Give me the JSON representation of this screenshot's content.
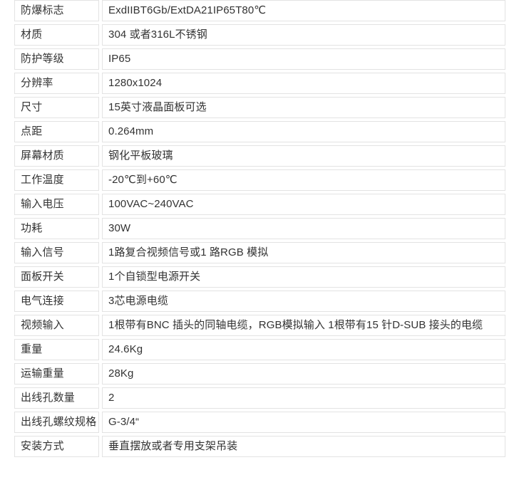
{
  "table": {
    "rows": [
      {
        "label": "防爆标志",
        "value": "ExdIIBT6Gb/ExtDA21IP65T80℃"
      },
      {
        "label": "材质",
        "value": "304 或者316L不锈钢"
      },
      {
        "label": "防护等级",
        "value": "IP65"
      },
      {
        "label": "分辨率",
        "value": "1280x1024"
      },
      {
        "label": "尺寸",
        "value": "15英寸液晶面板可选"
      },
      {
        "label": "点距",
        "value": "0.264mm"
      },
      {
        "label": "屏幕材质",
        "value": "钢化平板玻璃"
      },
      {
        "label": "工作温度",
        "value": "-20℃到+60℃"
      },
      {
        "label": "输入电压",
        "value": "100VAC~240VAC"
      },
      {
        "label": "功耗",
        "value": "30W"
      },
      {
        "label": "输入信号",
        "value": "1路复合视频信号或1 路RGB 模拟"
      },
      {
        "label": "面板开关",
        "value": "1个自锁型电源开关"
      },
      {
        "label": "电气连接",
        "value": "3芯电源电缆"
      },
      {
        "label": "视频输入",
        "value": "1根带有BNC 插头的同轴电缆，RGB模拟输入 1根带有15 针D-SUB 接头的电缆"
      },
      {
        "label": "重量",
        "value": "24.6Kg"
      },
      {
        "label": "运输重量",
        "value": "28Kg"
      },
      {
        "label": "出线孔数量",
        "value": "2"
      },
      {
        "label": "出线孔螺纹规格",
        "value": "G-3/4“"
      },
      {
        "label": "安装方式",
        "value": "垂直摆放或者专用支架吊装"
      }
    ]
  },
  "colors": {
    "border": "#e3e3e3",
    "text": "#333333",
    "background": "#ffffff"
  }
}
